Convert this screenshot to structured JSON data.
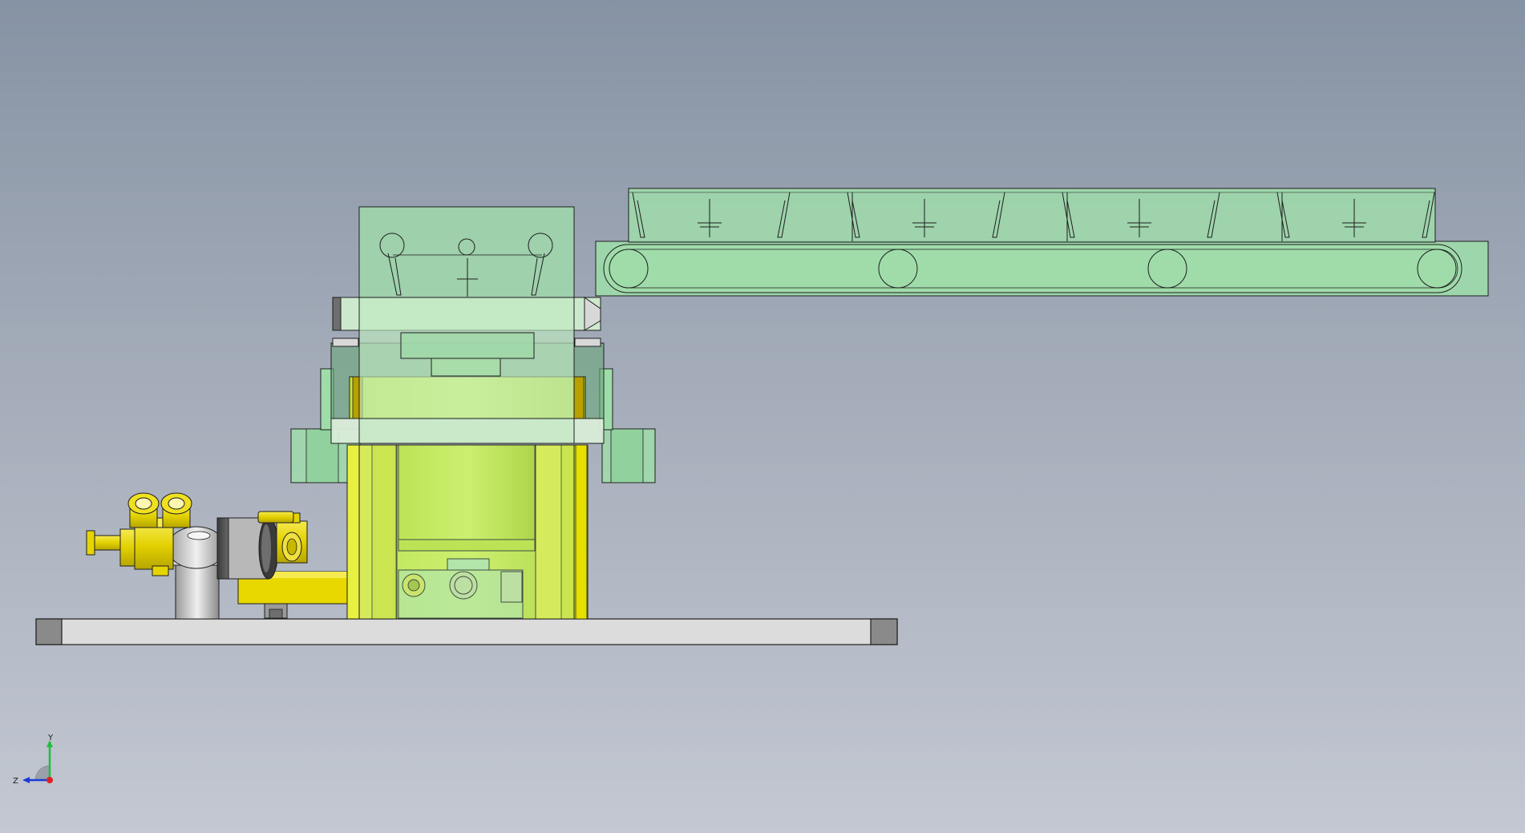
{
  "viewport": {
    "background_top": "#8693a4",
    "background_bottom": "#c3c8d2"
  },
  "colors": {
    "transparent_green": "#9fdcaa",
    "yellow_part": "#d8f05a",
    "bright_yellow": "#e8e81c",
    "brass_yellow": "#e6d400",
    "steel_gray": "#d8d8d8",
    "dark_gray": "#6e6e6e",
    "edge": "#1e1e1e"
  },
  "triad": {
    "y_label": "Y",
    "z_label": "Z",
    "y_axis_color": "#1fbf3a",
    "z_axis_color": "#1a3ad8",
    "origin_color": "#e02020"
  },
  "parts": [
    "base-plate",
    "vertical-housing",
    "cylinder-body",
    "support-flanges",
    "conveyor-belt",
    "conveyor-cleats",
    "valve-assembly",
    "pneumatic-fittings",
    "elbow-fitting",
    "mounting-bracket"
  ]
}
